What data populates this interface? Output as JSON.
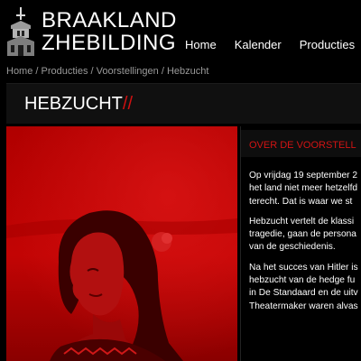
{
  "brand": {
    "line1": "BRAAKLAND",
    "line2": "ZHEBILDING",
    "logo_icon": "church-tower-icon"
  },
  "nav": {
    "items": [
      {
        "label": "Home"
      },
      {
        "label": "Kalender"
      },
      {
        "label": "Producties"
      }
    ]
  },
  "breadcrumb": {
    "home": "Home",
    "sep": " / ",
    "producties": "Producties",
    "voorstellingen": "Voorstellingen",
    "current": "Hebzucht"
  },
  "page": {
    "title": "HEBZUCHT",
    "title_accent": "//"
  },
  "panel": {
    "heading": "OVER DE VOORSTELL",
    "paragraphs": [
      [
        "Op vrijdag 19 september 2",
        "het land niet meer hetzelfd",
        "terecht. Dat is waar we st"
      ],
      [
        "Hebzucht vertelt de klassi",
        "tragedie, gaan de persona",
        "van de geschiedenis."
      ],
      [
        "Na het succes van Hitler is",
        "hebzucht van de hedge fu",
        "in De Standaard en de uitv",
        "Theatermaker waren alvas"
      ]
    ]
  },
  "colors": {
    "accent": "#d01010",
    "background": "#000000",
    "photo_tint": "#c00000"
  }
}
